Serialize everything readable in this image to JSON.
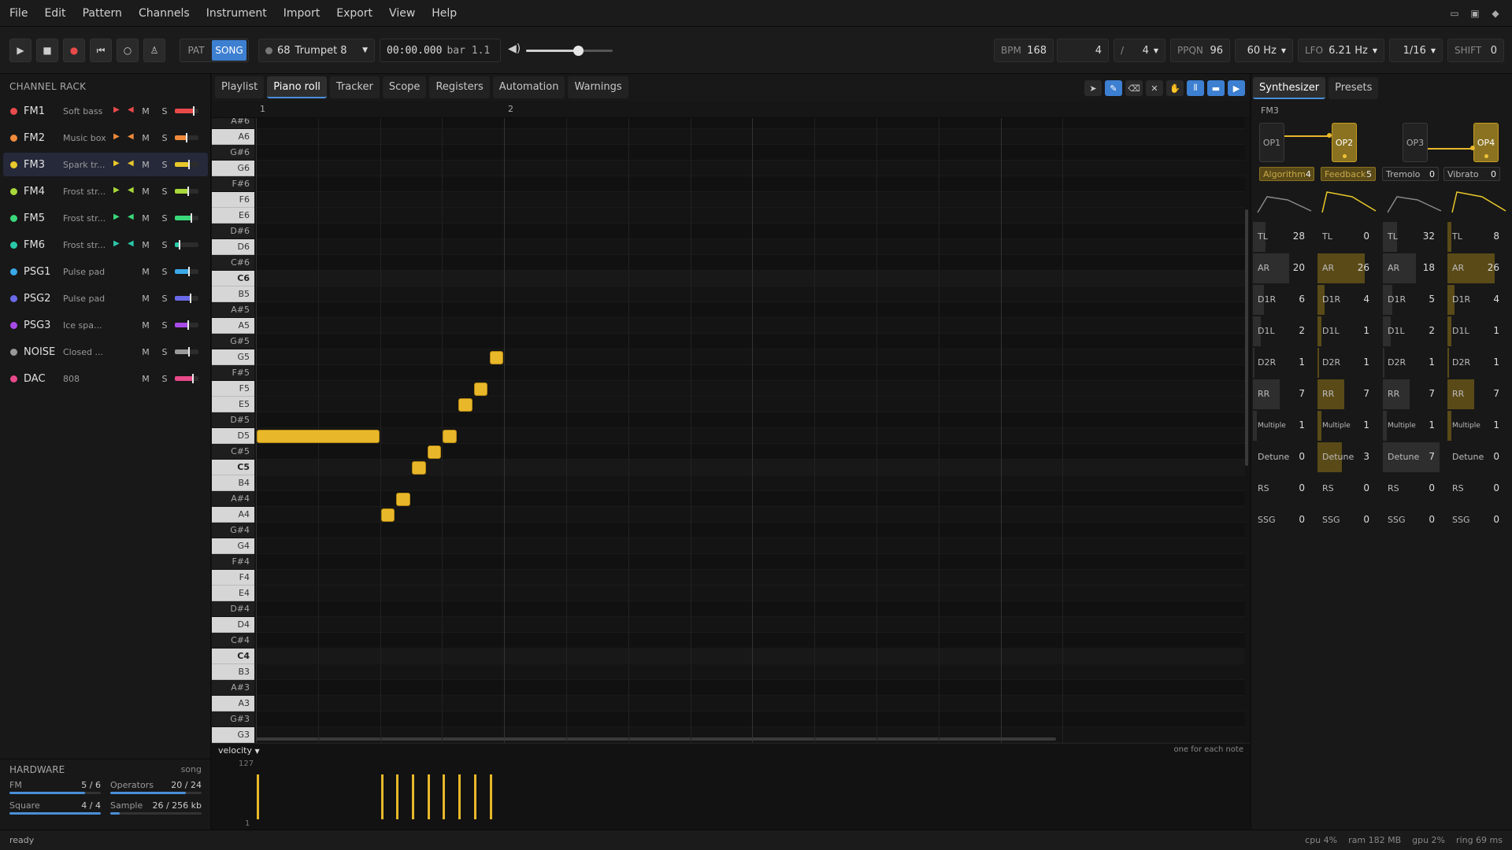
{
  "menu": [
    "File",
    "Edit",
    "Pattern",
    "Channels",
    "Instrument",
    "Import",
    "Export",
    "View",
    "Help"
  ],
  "transport": {
    "pat": "PAT",
    "song": "SONG",
    "instrument_num": "68",
    "instrument_name": "Trumpet 8",
    "time": "00:00.000",
    "bar": "bar 1.1",
    "volume": 0.6,
    "bpm_label": "BPM",
    "bpm": "168",
    "beats": "4",
    "slash": "/",
    "beat_unit": "4",
    "ppqn_label": "PPQN",
    "ppqn": "96",
    "rate": "60 Hz",
    "lfo_label": "LFO",
    "lfo": "6.21 Hz",
    "snap": "1/16",
    "shift_label": "SHIFT",
    "shift": "0"
  },
  "rack": {
    "title": "CHANNEL RACK",
    "channels": [
      {
        "name": "FM1",
        "inst": "Soft bass",
        "color": "#e84a4a",
        "fm": true,
        "vol": 0.8
      },
      {
        "name": "FM2",
        "inst": "Music box",
        "color": "#ef8a3c",
        "fm": true,
        "vol": 0.5
      },
      {
        "name": "FM3",
        "inst": "Spark tr...",
        "color": "#e8c82a",
        "fm": true,
        "vol": 0.6,
        "selected": true
      },
      {
        "name": "FM4",
        "inst": "Frost str...",
        "color": "#a8d83a",
        "fm": true,
        "vol": 0.55
      },
      {
        "name": "FM5",
        "inst": "Frost str...",
        "color": "#3ad87a",
        "fm": true,
        "vol": 0.7
      },
      {
        "name": "FM6",
        "inst": "Frost str...",
        "color": "#2ac8a8",
        "fm": true,
        "vol": 0.2
      },
      {
        "name": "PSG1",
        "inst": "Pulse pad",
        "color": "#3aa8e8",
        "fm": false,
        "vol": 0.6
      },
      {
        "name": "PSG2",
        "inst": "Pulse pad",
        "color": "#6a6ae8",
        "fm": false,
        "vol": 0.65
      },
      {
        "name": "PSG3",
        "inst": "Ice spa...",
        "color": "#a84ae8",
        "fm": false,
        "vol": 0.55
      },
      {
        "name": "NOISE",
        "inst": "Closed ...",
        "color": "#999999",
        "fm": false,
        "vol": 0.6
      },
      {
        "name": "DAC",
        "inst": "808",
        "color": "#e84a8a",
        "fm": false,
        "vol": 0.75
      }
    ]
  },
  "hardware": {
    "title": "HARDWARE",
    "mode": "song",
    "fm_label": "FM",
    "fm": "5 / 6",
    "fm_frac": 0.83,
    "ops_label": "Operators",
    "ops": "20 / 24",
    "ops_frac": 0.83,
    "sq_label": "Square",
    "sq": "4 / 4",
    "sq_frac": 1.0,
    "sample_label": "Sample",
    "sample": "26 / 256 kb",
    "sample_frac": 0.1
  },
  "tabs": [
    "Playlist",
    "Piano roll",
    "Tracker",
    "Scope",
    "Registers",
    "Automation",
    "Warnings"
  ],
  "active_tab": 1,
  "ruler": [
    "1",
    "2"
  ],
  "keys": [
    "A#6",
    "A6",
    "G#6",
    "G6",
    "F#6",
    "F6",
    "E6",
    "D#6",
    "D6",
    "C#6",
    "C6",
    "B5",
    "A#5",
    "A5",
    "G#5",
    "G5",
    "F#5",
    "F5",
    "E5",
    "D#5",
    "D5",
    "C#5",
    "C5",
    "B4",
    "A#4",
    "A4",
    "G#4",
    "G4",
    "F#4",
    "F4",
    "E4",
    "D#4",
    "D4",
    "C#4",
    "C4",
    "B3",
    "A#3",
    "A3",
    "G#3",
    "G3"
  ],
  "notes": [
    {
      "key": "D5",
      "step": 0,
      "len": 8
    },
    {
      "key": "A4",
      "step": 8,
      "len": 1
    },
    {
      "key": "A#4",
      "step": 9,
      "len": 1
    },
    {
      "key": "C5",
      "step": 10,
      "len": 1
    },
    {
      "key": "C#5",
      "step": 11,
      "len": 1
    },
    {
      "key": "D5",
      "step": 12,
      "len": 1
    },
    {
      "key": "E5",
      "step": 13,
      "len": 1
    },
    {
      "key": "F5",
      "step": 14,
      "len": 1
    },
    {
      "key": "G5",
      "step": 15,
      "len": 1
    }
  ],
  "velocity": {
    "label": "velocity",
    "hint": "one for each note",
    "max": "127",
    "min": "1",
    "values": [
      100,
      100,
      100,
      100,
      100,
      100,
      100,
      100,
      100
    ]
  },
  "synth": {
    "tabs": [
      "Synthesizer",
      "Presets"
    ],
    "name": "FM3",
    "ops": [
      "OP1",
      "OP2",
      "OP3",
      "OP4"
    ],
    "algorithm_label": "Algorithm",
    "algorithm": "4",
    "feedback_label": "Feedback",
    "feedback": "5",
    "tremolo_label": "Tremolo",
    "tremolo": "0",
    "vibrato_label": "Vibrato",
    "vibrato": "0",
    "params": [
      "TL",
      "AR",
      "D1R",
      "D1L",
      "D2R",
      "RR",
      "Multiple",
      "Detune",
      "RS",
      "SSG"
    ],
    "values": [
      [
        "28",
        "20",
        "6",
        "2",
        "1",
        "7",
        "1",
        "0",
        "0",
        "0"
      ],
      [
        "0",
        "26",
        "4",
        "1",
        "1",
        "7",
        "1",
        "3",
        "0",
        "0"
      ],
      [
        "32",
        "18",
        "5",
        "2",
        "1",
        "7",
        "1",
        "7",
        "0",
        "0"
      ],
      [
        "8",
        "26",
        "4",
        "1",
        "1",
        "7",
        "1",
        "0",
        "0",
        "0"
      ]
    ],
    "max": [
      127,
      31,
      31,
      15,
      31,
      15,
      15,
      7,
      3,
      15
    ]
  },
  "status": {
    "left": "ready",
    "cpu": "cpu 4%",
    "ram": "ram 182 MB",
    "gpu": "gpu 2%",
    "ring": "ring 69 ms"
  }
}
